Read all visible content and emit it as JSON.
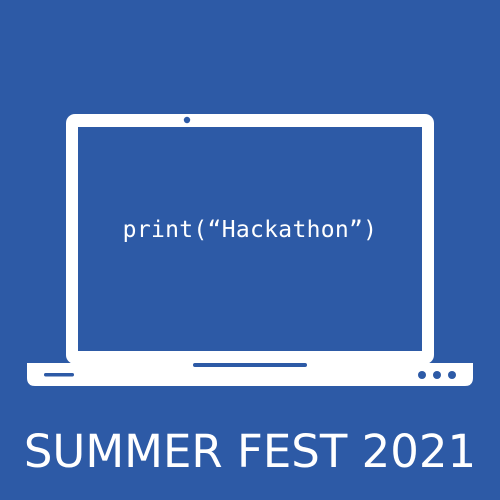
{
  "code_text": "print(“Hackathon”)",
  "title": "SUMMER FEST 2021",
  "colors": {
    "background": "#2d5aa6",
    "foreground": "#ffffff"
  },
  "icon": "laptop-icon"
}
